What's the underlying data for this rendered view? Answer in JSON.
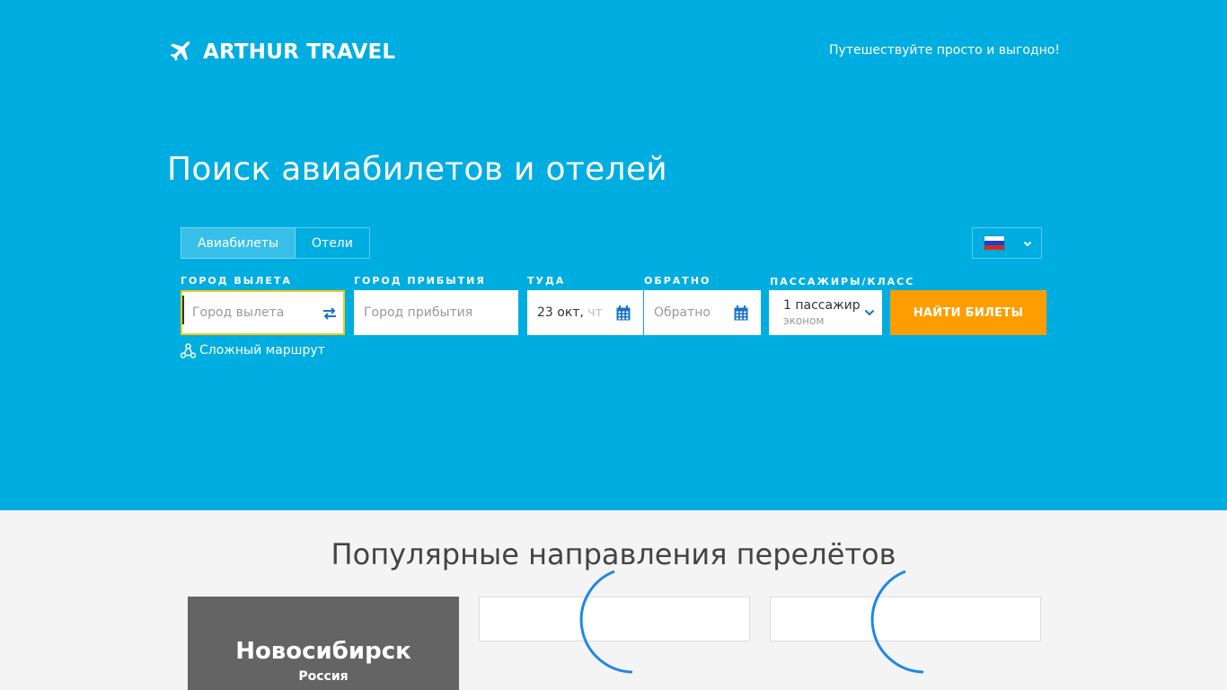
{
  "header": {
    "brand": "ARTHUR TRAVEL",
    "tagline": "Путешествуйте просто и выгодно!"
  },
  "hero": {
    "title": "Поиск авиабилетов и отелей"
  },
  "tabs": [
    {
      "label": "Авиабилеты",
      "active": true
    },
    {
      "label": "Отели",
      "active": false
    }
  ],
  "language": {
    "selected": "ru",
    "flag_colors": [
      "#ffffff",
      "#1c3fd1",
      "#d52b1e"
    ]
  },
  "form": {
    "from": {
      "label": "ГОРОД ВЫЛЕТА",
      "placeholder": "Город вылета",
      "value": ""
    },
    "to": {
      "label": "ГОРОД ПРИБЫТИЯ",
      "placeholder": "Город прибытия",
      "value": ""
    },
    "depart": {
      "label": "ТУДА",
      "value": "23 окт, ",
      "value_faded": "чт"
    },
    "return": {
      "label": "ОБРАТНО",
      "placeholder": "Обратно"
    },
    "passengers": {
      "label": "ПАССАЖИРЫ/КЛАСС",
      "count": "1 пассажир",
      "class": "эконом"
    },
    "submit_label": "НАЙТИ БИЛЕТЫ",
    "complex_route": "Сложный маршрут"
  },
  "popular": {
    "title": "Популярные направления перелётов",
    "cards": [
      {
        "city": "Новосибирск",
        "country": "Россия"
      }
    ]
  },
  "colors": {
    "hero_bg": "#00ade0",
    "accent_orange": "#ff9d00",
    "focus_yellow": "#f6c90e",
    "spinner_blue": "#1e88e5"
  },
  "icons": {
    "logo": "airplane-icon",
    "swap": "swap-arrows-icon",
    "calendar": "calendar-icon",
    "dropdown": "chevron-down-icon",
    "route": "route-nodes-icon",
    "loading": "loading-spinner-icon"
  }
}
